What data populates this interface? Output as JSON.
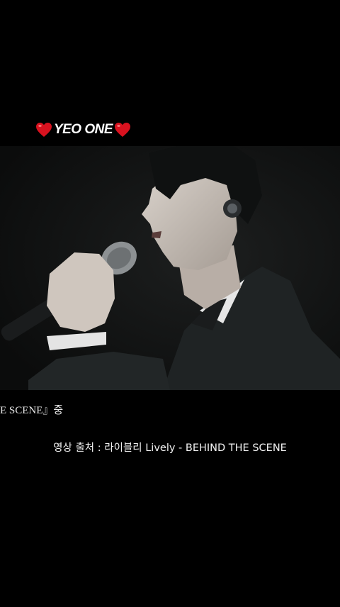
{
  "header": {
    "title": "YEO ONE",
    "left_icon": "heart-icon",
    "right_icon": "heart-icon",
    "heart_color": "#d8121f"
  },
  "video": {
    "subtitle_fragment": "E SCENE』중",
    "credit": "영상 출처 : 라이블리 Lively - BEHIND THE SCENE"
  },
  "colors": {
    "background": "#000000",
    "text": "#ffffff"
  }
}
